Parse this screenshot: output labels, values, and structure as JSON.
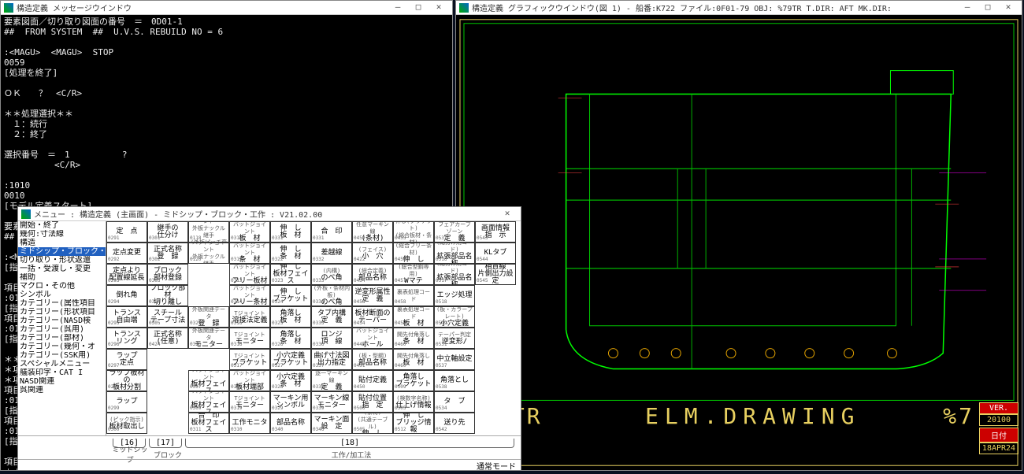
{
  "msg_win": {
    "title": "構造定義 メッセージウインドウ",
    "lines": [
      "要素図面／切り取り図面の番号　＝　0D01-1",
      "##  FROM SYSTEM  ##  U.V.S. REBUILD NO = 6",
      "",
      ":<MAGU>  <MAGU>  STOP",
      "0059",
      "[処理を終了]",
      "",
      "ＯＫ　　？　<C/R>",
      "",
      "＊＊処理選択＊＊",
      "　１：続行",
      "　２：終了",
      "",
      "選択番号　＝　1          ?",
      "        　<C/R>",
      "",
      ":1010",
      "0010",
      "[モデル定義スタート]",
      "",
      "要素図面／切り取り図面の番号　＝　0F01-79",
      "##  FROM SYSTEM  ##  U.V.S. REBUILD NO = 6",
      "",
      ":<M",
      "[指開始・終了",
      "   幾何:寸法線",
      "項目構造",
      ":01ミドシップ・ブロック・工",
      "[指 切り取り・形状返還",
      "項目 一括・受渡し・変更",
      ":01 補助",
      "[指 マクロ・その他",
      "   シンボル",
      "＊＊カテゴリー(属性項目",
      "＊項カテゴリー(形状項目",
      "＊項カテゴリー(NASD検",
      "項目カテゴリー(呉用)",
      ":01カテゴリー(部材)",
      "[指カテゴリー(幾何・オ",
      "項目カテゴリー(SSK用)",
      ":01スペシャルメニュー",
      "[指艤装印字・CAT I",
      "   NASD関連",
      "項目呉関連",
      "＊＊",
      "＊項",
      "項目",
      "項目"
    ]
  },
  "gfx_win": {
    "title": "構造定義 グラフィックウインドウ(図 1)  - 船番:K722 ファイル:0F01-79  OBJ: %79TR    T.DIR: AFT    MK.DIR:",
    "label_left": "9TR",
    "label_center": "ELM.DRAWING",
    "label_right": "%7",
    "ver_label": "VER.",
    "ver_value": "20100",
    "date_label": "日付",
    "date_value": "18APR24"
  },
  "menu_win": {
    "title": "メニュー : 構造定義 (主画面) - ミドシップ・ブロック・工作 : V21.02.00",
    "left_items": [
      {
        "t": "開始・終了",
        "sel": false
      },
      {
        "t": "幾何:寸法線",
        "sel": false
      },
      {
        "t": "構造",
        "sel": false
      },
      {
        "t": "ミドシップ・ブロック・工",
        "sel": true
      },
      {
        "t": "切り取り・形状返還",
        "sel": false
      },
      {
        "t": "一括・受渡し・変更",
        "sel": false
      },
      {
        "t": "補助",
        "sel": false
      },
      {
        "t": "マクロ・その他",
        "sel": false
      },
      {
        "t": "シンボル",
        "sel": false
      },
      {
        "t": "カテゴリー(属性項目",
        "sel": false
      },
      {
        "t": "カテゴリー(形状項目",
        "sel": false
      },
      {
        "t": "カテゴリー(NASD検",
        "sel": false
      },
      {
        "t": "カテゴリー(呉用)",
        "sel": false
      },
      {
        "t": "カテゴリー(部材)",
        "sel": false
      },
      {
        "t": "カテゴリー(幾何・オ",
        "sel": false
      },
      {
        "t": "カテゴリー(SSK用)",
        "sel": false
      },
      {
        "t": "スペシャルメニュー",
        "sel": false
      },
      {
        "t": "艤装印字・CAT I",
        "sel": false
      },
      {
        "t": "NASD関連",
        "sel": false
      },
      {
        "t": "呉関連",
        "sel": false
      }
    ],
    "cells": [
      {
        "c": 0,
        "r": 0,
        "t": "定　点",
        "n": "0291"
      },
      {
        "c": 0,
        "r": 1,
        "t": "定点変更",
        "n": "0292"
      },
      {
        "c": 0,
        "r": 2,
        "t": "定点より\n配置線延長",
        "n": "0293"
      },
      {
        "c": 0,
        "r": 3,
        "t": "倒れ角",
        "n": "0294"
      },
      {
        "c": 0,
        "r": 4,
        "t": "トランス\n自由端",
        "n": "0295"
      },
      {
        "c": 0,
        "r": 5,
        "t": "トランス\nリング",
        "n": "0296"
      },
      {
        "c": 0,
        "r": 6,
        "t": "ラップ\n定点",
        "n": "0297"
      },
      {
        "c": 0,
        "r": 7,
        "t": "ラップ板材の\n板材分割",
        "n": "0298"
      },
      {
        "c": 0,
        "r": 8,
        "t": "ラップ",
        "n": "0299"
      },
      {
        "c": 0,
        "r": 9,
        "t": "板材取出し",
        "s": "(ピック指示)",
        "n": "0300"
      },
      {
        "c": 1,
        "r": 0,
        "t": "継手の\n仕分け",
        "n": "0301"
      },
      {
        "c": 1,
        "r": 1,
        "t": "正式名称\n登　録",
        "n": "0302"
      },
      {
        "c": 1,
        "r": 2,
        "t": "ブロック\n部材登録",
        "n": "0303"
      },
      {
        "c": 1,
        "r": 3,
        "t": "ブロック部材\n切り離し",
        "n": "0304"
      },
      {
        "c": 1,
        "r": 4,
        "t": "スチール\nテープ寸法",
        "n": "0305"
      },
      {
        "c": 1,
        "r": 5,
        "t": "正式名称\n(任意)",
        "n": "0424"
      },
      {
        "c": 2,
        "r": 0,
        "s": "バットジョイント\n外板ナックル継手\n(外板ピッチ変化)",
        "n": "0118"
      },
      {
        "c": 2,
        "r": 1,
        "s": "バットジョイント\n外板ナックル継手",
        "n": "0120"
      },
      {
        "c": 2,
        "r": 4,
        "s": "外板関連データ",
        "t": "登　録",
        "n": "0325"
      },
      {
        "c": 2,
        "r": 5,
        "s": "外板関連データ",
        "t": "モニター",
        "n": "0326"
      },
      {
        "c": 2,
        "r": 7,
        "s": "バットジョイント",
        "t": "板材フェイス",
        "n": "0307"
      },
      {
        "c": 2,
        "r": 8,
        "s": "バットジョイント",
        "t": "板材フェイス",
        "n": "0309"
      },
      {
        "c": 2,
        "r": 9,
        "t": "合　印\n板材フェイス",
        "n": "0311"
      },
      {
        "c": 3,
        "r": 0,
        "s": "バットジョイント",
        "t": "板　材",
        "n": "0316"
      },
      {
        "c": 3,
        "r": 1,
        "s": "バットジョイント",
        "t": "条　材",
        "n": "0312"
      },
      {
        "c": 3,
        "r": 2,
        "s": "バットジョイント",
        "t": "フリー板材",
        "n": "0313"
      },
      {
        "c": 3,
        "r": 3,
        "s": "バットジョイント",
        "t": "フリー条材",
        "n": "0314"
      },
      {
        "c": 3,
        "r": 4,
        "s": "Tジョイント",
        "t": "溶接法定義",
        "n": "0316"
      },
      {
        "c": 3,
        "r": 5,
        "s": "Tジョイント",
        "t": "モニター",
        "n": "0316"
      },
      {
        "c": 3,
        "r": 6,
        "s": "Tジョイント",
        "t": "ブラケット",
        "n": "0317"
      },
      {
        "c": 3,
        "r": 7,
        "s": "バットジョイント",
        "t": "板材端部",
        "n": "0318"
      },
      {
        "c": 3,
        "r": 8,
        "s": "Tジョイント",
        "t": "モニター",
        "n": "0319"
      },
      {
        "c": 3,
        "r": 9,
        "t": "工作モニタ",
        "n": "0310"
      },
      {
        "c": 4,
        "r": 0,
        "t": "伸　し\n板　材",
        "n": "0331"
      },
      {
        "c": 4,
        "r": 1,
        "t": "伸　し\n条　材",
        "n": "0322"
      },
      {
        "c": 4,
        "r": 2,
        "t": "伸　し\n板材フェイス",
        "n": "0323"
      },
      {
        "c": 4,
        "r": 3,
        "t": "伸　し\nブラケット",
        "n": "0324"
      },
      {
        "c": 4,
        "r": 4,
        "t": "角落し\n板　材",
        "n": "0325"
      },
      {
        "c": 4,
        "r": 5,
        "t": "角落し\n条　材",
        "n": "0326"
      },
      {
        "c": 4,
        "r": 6,
        "t": "小穴定義\nブラケット",
        "n": "0327"
      },
      {
        "c": 4,
        "r": 7,
        "t": "小穴定義\n条　材",
        "n": "0328"
      },
      {
        "c": 4,
        "r": 8,
        "t": "マーキン用\nシンボル",
        "n": "0329"
      },
      {
        "c": 4,
        "r": 9,
        "t": "部品名称",
        "n": "0340"
      },
      {
        "c": 5,
        "r": 0,
        "t": "合　印",
        "n": "0331"
      },
      {
        "c": 5,
        "r": 1,
        "t": "差越線",
        "n": "0332"
      },
      {
        "c": 5,
        "r": 2,
        "t": "のべ角",
        "s": "(内構)",
        "n": "0333"
      },
      {
        "c": 5,
        "r": 3,
        "t": "のべ角",
        "s": "(外板・条材内板)",
        "n": "0334"
      },
      {
        "c": 5,
        "r": 4,
        "t": "タブ内構\n定　義",
        "n": "0335"
      },
      {
        "c": 5,
        "r": 5,
        "t": "ロンジ\n頂　線",
        "n": "0336"
      },
      {
        "c": 5,
        "r": 6,
        "t": "曲げ寸法図\n出力指定",
        "n": "0337"
      },
      {
        "c": 5,
        "r": 7,
        "s": "逐一マーキン線",
        "t": "定　義",
        "n": "0338"
      },
      {
        "c": 5,
        "r": 8,
        "t": "マーキン線\nモニター",
        "n": "0339"
      },
      {
        "c": 5,
        "r": 9,
        "t": "マーキン面\n設　定",
        "n": "0346"
      },
      {
        "c": 6,
        "r": 0,
        "s": "任意マーキン線",
        "t": "(条材)",
        "n": "0459"
      },
      {
        "c": 6,
        "r": 1,
        "t": "小　穴",
        "s": "(フェイス)",
        "n": "0422"
      },
      {
        "c": 6,
        "r": 2,
        "t": "部品名称",
        "s": "(総合定義)",
        "n": "0434"
      },
      {
        "c": 6,
        "r": 3,
        "t": "逆変形属性\n定　義",
        "n": "0458"
      },
      {
        "c": 6,
        "r": 4,
        "t": "板材断面の\nテーパー",
        "n": "0454"
      },
      {
        "c": 6,
        "r": 5,
        "s": "バットジョイント",
        "t": "ホ－ル",
        "n": "0446"
      },
      {
        "c": 6,
        "r": 6,
        "t": "部品名称",
        "s": "(板・型鋼)",
        "n": "0451"
      },
      {
        "c": 6,
        "r": 7,
        "t": "貼付定義",
        "n": "0450"
      },
      {
        "c": 6,
        "r": 8,
        "t": "貼付位置\n指　定",
        "n": "0500"
      },
      {
        "c": 6,
        "r": 9,
        "t": "伸　し",
        "s": "(条材)\n(共通テーブル)",
        "n": "0505"
      },
      {
        "c": 7,
        "r": 0,
        "s": "伸し(ブラケット)\n(総合板材・条材)",
        "n": "0455"
      },
      {
        "c": 7,
        "r": 1,
        "t": "伸　し",
        "s": "(総合フリー条材)",
        "n": "0456"
      },
      {
        "c": 7,
        "r": 2,
        "t": "Wマテ",
        "s": "(総合型鋼専用)",
        "n": "0457"
      },
      {
        "c": 7,
        "r": 3,
        "s": "裏表処理コード",
        "n": "0458"
      },
      {
        "c": 7,
        "r": 4,
        "s": "裏表処理コード",
        "t": "板　材",
        "n": "0459"
      },
      {
        "c": 7,
        "r": 5,
        "s": "開先付角落し",
        "t": "条　材",
        "n": "0460"
      },
      {
        "c": 7,
        "r": 6,
        "s": "開先付角落し",
        "t": "板　材",
        "n": "0460"
      },
      {
        "c": 7,
        "r": 7,
        "t": "角落し\nブラケット",
        "n": "0509"
      },
      {
        "c": 7,
        "r": 8,
        "t": "仕上げ情報",
        "s": "(検数字名称)",
        "n": "0505"
      },
      {
        "c": 7,
        "r": 9,
        "t": "伸　し\nブリッジ情報",
        "n": "0512"
      },
      {
        "c": 8,
        "r": 0,
        "s": "フェアカーブゾーン",
        "t": "定　義",
        "n": "0531"
      },
      {
        "c": 8,
        "r": 1,
        "t": "拡張部品名称",
        "s": "(総分け用コード)",
        "n": "0516"
      },
      {
        "c": 8,
        "r": 2,
        "t": "拡張部品名称",
        "s": "(総分け用コード)",
        "n": "0517"
      },
      {
        "c": 8,
        "r": 3,
        "t": "エッジ処理",
        "s": "",
        "n": "0518"
      },
      {
        "c": 8,
        "r": 4,
        "t": "小穴定義",
        "s": "(板・カラープレート)",
        "n": "0519"
      },
      {
        "c": 8,
        "r": 5,
        "t": "逆変形/",
        "s": "テーパー判定",
        "n": "0531"
      },
      {
        "c": 8,
        "r": 6,
        "t": "中立軸設定",
        "n": "0537"
      },
      {
        "c": 8,
        "r": 7,
        "t": "角落とし",
        "n": "0538"
      },
      {
        "c": 8,
        "r": 8,
        "t": "タ　ブ",
        "s": "",
        "n": "0534"
      },
      {
        "c": 8,
        "r": 9,
        "t": "送り先",
        "n": "0542"
      },
      {
        "c": 9,
        "r": 0,
        "t": "画面情報\n指　示",
        "n": "0543"
      },
      {
        "c": 9,
        "r": 1,
        "t": "KLタブ",
        "n": "0544"
      },
      {
        "c": 9,
        "r": 2,
        "t": "相貫線\n片側出力設定",
        "n": "0545"
      }
    ],
    "footer_tabs": [
      "[16]",
      "[17]",
      "[18]"
    ],
    "footer_labels": [
      "ミッドシップ",
      "ブロック",
      "工作/加工法"
    ],
    "status": "通常モード"
  }
}
